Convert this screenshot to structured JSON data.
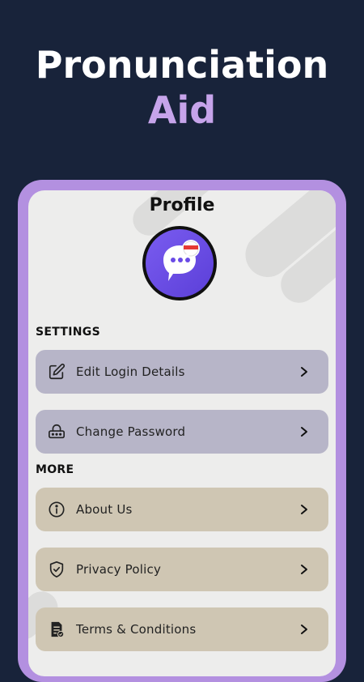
{
  "headline": {
    "line1": "Pronunciation",
    "line2": "Aid"
  },
  "screen": {
    "title": "Profile",
    "settings_header": "SETTINGS",
    "more_header": "MORE",
    "settings_items": [
      {
        "label": "Edit Login Details",
        "icon": "edit-icon"
      },
      {
        "label": "Change Password",
        "icon": "lock-icon"
      }
    ],
    "more_items": [
      {
        "label": "About Us",
        "icon": "info-icon"
      },
      {
        "label": "Privacy Policy",
        "icon": "shield-icon"
      },
      {
        "label": "Terms & Conditions",
        "icon": "document-icon"
      }
    ]
  },
  "colors": {
    "background": "#18233a",
    "accent": "#c6a4ea",
    "phone_frame": "#b390e0",
    "settings_item_bg": "#b7b5c8",
    "more_item_bg": "#cfc6b3"
  }
}
